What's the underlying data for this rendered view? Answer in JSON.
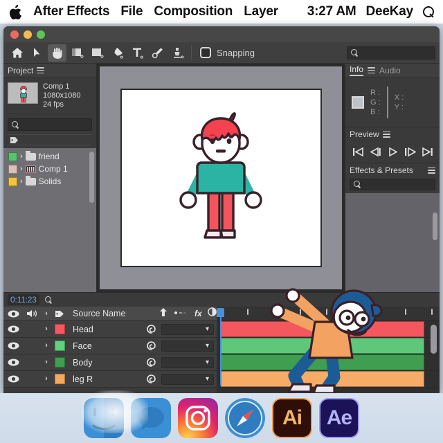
{
  "menubar": {
    "apple_icon": "apple-logo",
    "items": [
      "After Effects",
      "File",
      "Composition",
      "Layer"
    ],
    "time": "3:27 AM",
    "user": "DeeKay",
    "search_icon": "search-icon"
  },
  "window": {
    "traffic_lights": [
      "close",
      "minimize",
      "maximize"
    ]
  },
  "toolbar": {
    "tools": [
      {
        "name": "home-icon",
        "label": "Home"
      },
      {
        "name": "selection-arrow-icon",
        "label": "Selection Tool"
      },
      {
        "name": "hand-icon",
        "label": "Hand Tool"
      },
      {
        "name": "zoom-region-icon",
        "label": "Zoom Tool"
      },
      {
        "name": "rotate-icon",
        "label": "Rotation Tool"
      },
      {
        "name": "pen-icon",
        "label": "Pen Tool"
      },
      {
        "name": "text-icon",
        "label": "Type Tool"
      },
      {
        "name": "brush-icon",
        "label": "Brush Tool"
      },
      {
        "name": "clone-stamp-icon",
        "label": "Clone Stamp Tool"
      }
    ],
    "snapping_label": "Snapping",
    "snapping_checked": false,
    "search_icon": "search-icon",
    "search_value": "",
    "search_placeholder": ""
  },
  "project": {
    "title": "Project",
    "menu_icon": "hamburger-icon",
    "comp_name": "Comp 1",
    "comp_resolution": "1080x1080",
    "comp_fps": "24 fps",
    "search_icon": "search-icon",
    "search_value": "",
    "tag_icon": "tag-icon",
    "items": [
      {
        "label": "friend",
        "color": "#57c36c",
        "icon": "folder-icon",
        "chevron": "chevron-right-icon"
      },
      {
        "label": "Comp 1",
        "color": "#d9c0b8",
        "icon": "composition-icon",
        "chevron": "chevron-right-icon"
      },
      {
        "label": "Solids",
        "color": "#f2c53d",
        "icon": "folder-icon",
        "chevron": "chevron-right-icon"
      }
    ]
  },
  "composition": {
    "character": {
      "hair_color": "#f4424f",
      "skin_color": "#fdfdfd",
      "shirt_color": "#2bb3a3",
      "pants_color": "#f4545c",
      "shoe_color": "#f9e4ec",
      "outline_color": "#3a2028"
    }
  },
  "info_panel": {
    "tabs": [
      {
        "label": "Info",
        "active": true
      },
      {
        "label": "Audio",
        "active": false
      }
    ],
    "menu_icon": "hamburger-icon",
    "channels": [
      "R :",
      "G :",
      "B :"
    ],
    "coords": [
      "X :",
      "Y :"
    ],
    "swatch_color": "#bdc2c9"
  },
  "preview_panel": {
    "title": "Preview",
    "menu_icon": "hamburger-icon",
    "controls": [
      {
        "name": "first-frame-button",
        "glyph": "first"
      },
      {
        "name": "previous-frame-button",
        "glyph": "prev"
      },
      {
        "name": "play-button",
        "glyph": "play"
      },
      {
        "name": "next-frame-button",
        "glyph": "next"
      },
      {
        "name": "last-frame-button",
        "glyph": "last"
      }
    ]
  },
  "effects_panel": {
    "title": "Effects & Presets",
    "menu_icon": "hamburger-icon",
    "search_icon": "search-icon",
    "search_value": ""
  },
  "timeline": {
    "current_time": "0:11:23",
    "search_icon": "search-icon",
    "search_value": "",
    "columns": {
      "eye_icon": "eye-icon",
      "audio_icon": "speaker-icon",
      "solo_icon": "chevron-right-icon",
      "lock_icon": "tag-icon",
      "source_name": "Source Name",
      "shy_icon": "shy-icon",
      "motion_blur_icon": "motion-blur-icon",
      "effects_icon": "fx",
      "adjustment_icon": "adjustment-icon"
    },
    "layers": [
      {
        "name": "Head",
        "color": "#f4585e",
        "track_color": "#f4585e",
        "visible": true,
        "spiral_icon": "parent-pickwhip-icon"
      },
      {
        "name": "Face",
        "color": "#5fd37a",
        "track_color": "#5fc77a",
        "visible": true,
        "spiral_icon": "parent-pickwhip-icon"
      },
      {
        "name": "Body",
        "color": "#3f9e50",
        "track_color": "#3f9e50",
        "visible": true,
        "spiral_icon": "parent-pickwhip-icon"
      },
      {
        "name": "leg R",
        "color": "#f5a95e",
        "track_color": "#f6ab67",
        "visible": true,
        "spiral_icon": "parent-pickwhip-icon"
      }
    ],
    "playhead_position": "0:11:23"
  },
  "overlay_character": {
    "hair_color": "#1c5c96",
    "skin_color": "#fdfdfd",
    "shirt_color": "#f4a261",
    "pants_color": "#1c5c96",
    "shoe_color": "#e8eaf0"
  },
  "dock": {
    "icons": [
      {
        "name": "finder-icon",
        "label": "Finder"
      },
      {
        "name": "messages-icon",
        "label": "Messages"
      },
      {
        "name": "instagram-icon",
        "label": "Instagram"
      },
      {
        "name": "safari-icon",
        "label": "Safari"
      },
      {
        "name": "illustrator-icon",
        "label": "Ai"
      },
      {
        "name": "after-effects-icon",
        "label": "Ae"
      }
    ]
  }
}
